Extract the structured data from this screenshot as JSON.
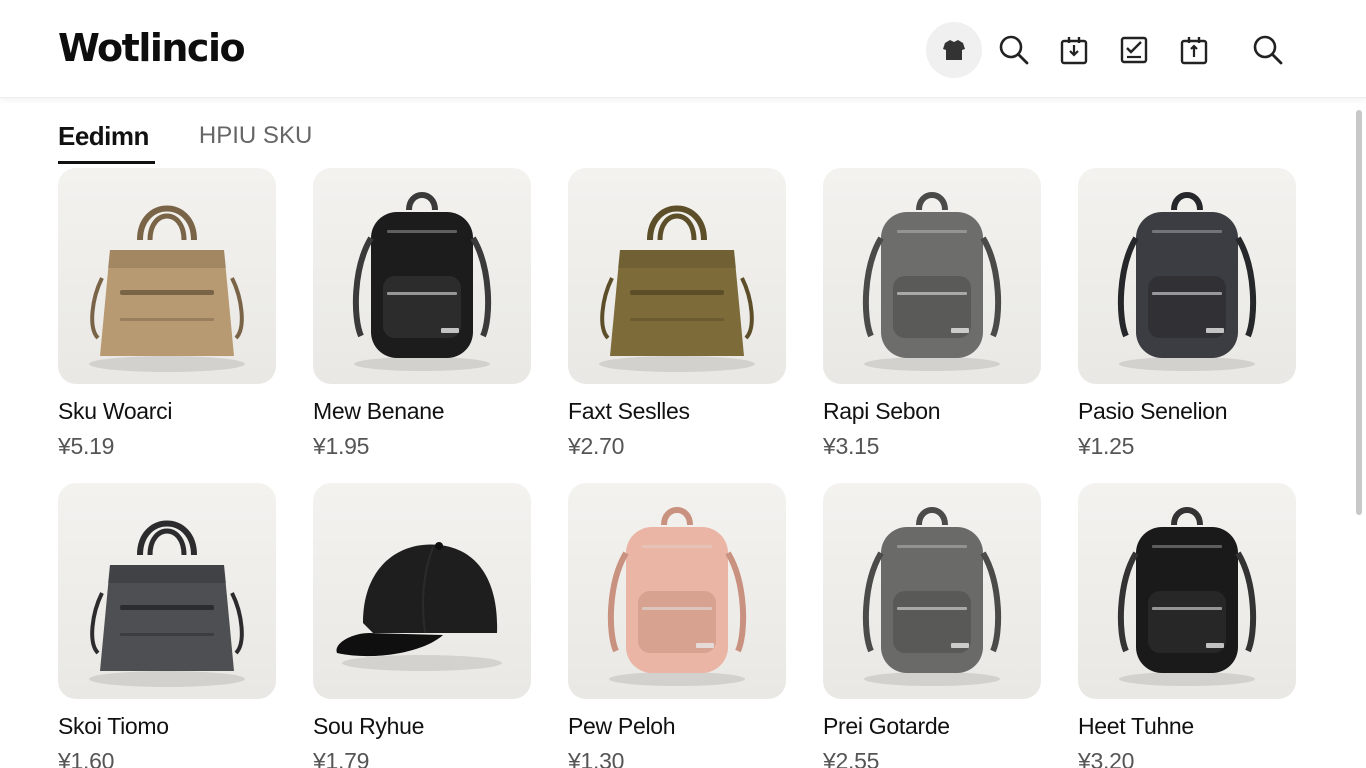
{
  "app": {
    "logo": "Wotlincio"
  },
  "header_icons": [
    {
      "name": "store-icon",
      "active": true
    },
    {
      "name": "search-icon"
    },
    {
      "name": "download-box-icon"
    },
    {
      "name": "checklist-icon"
    },
    {
      "name": "upload-box-icon"
    },
    {
      "name": "search-icon"
    }
  ],
  "tabs": [
    {
      "label": "Eedimn",
      "active": true
    },
    {
      "label": "HPIU SKU",
      "active": false
    }
  ],
  "products": [
    {
      "name": "Sku Woarci",
      "price": "¥5.19",
      "kind": "tote",
      "color": "#b89a72",
      "accent": "#7a6448"
    },
    {
      "name": "Mew Benane",
      "price": "¥1.95",
      "kind": "backpack",
      "color": "#1c1c1c",
      "accent": "#3a3a3a"
    },
    {
      "name": "Faxt Seslles",
      "price": "¥2.70",
      "kind": "tote",
      "color": "#7d6b3a",
      "accent": "#5c4e28"
    },
    {
      "name": "Rapi Sebon",
      "price": "¥3.15",
      "kind": "backpack",
      "color": "#6d6d6b",
      "accent": "#4a4a48"
    },
    {
      "name": "Pasio Senelion",
      "price": "¥1.25",
      "kind": "backpack",
      "color": "#3c3d42",
      "accent": "#26272b"
    },
    {
      "name": "Skoi Tiomo",
      "price": "¥1.60",
      "kind": "tote",
      "color": "#4e4f52",
      "accent": "#2c2c2e"
    },
    {
      "name": "Sou Ryhue",
      "price": "¥1.79",
      "kind": "cap",
      "color": "#1e1e1e",
      "accent": "#0f0f0f"
    },
    {
      "name": "Pew Peloh",
      "price": "¥1.30",
      "kind": "backpack",
      "color": "#eab5a4",
      "accent": "#c9917f"
    },
    {
      "name": "Prei Gotarde",
      "price": "¥2.55",
      "kind": "backpack",
      "color": "#6a6a68",
      "accent": "#4b4b49"
    },
    {
      "name": "Heet Tuhne",
      "price": "¥3.20",
      "kind": "backpack",
      "color": "#1a1a1a",
      "accent": "#333333"
    }
  ]
}
